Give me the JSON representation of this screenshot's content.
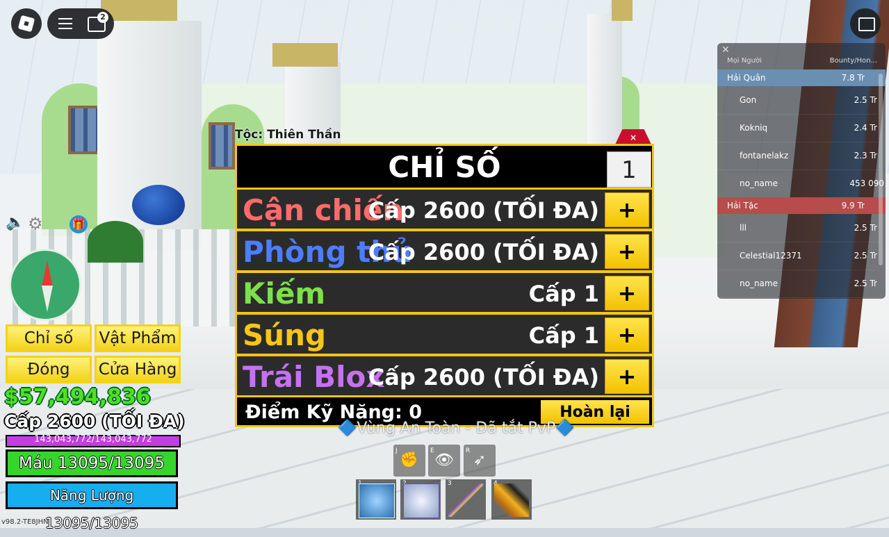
{
  "topbar": {
    "chat_badge": "2"
  },
  "leaderboard": {
    "col_name": "Mọi Người",
    "col_value": "Bounty/Hon...",
    "teams": [
      {
        "name": "Hải Quân",
        "value": "7.8 Tr",
        "color": "#6a8fb0",
        "players": [
          {
            "name": "Gon",
            "value": "2.5 Tr"
          },
          {
            "name": "Kokniq",
            "value": "2.4 Tr"
          },
          {
            "name": "fontanelakz",
            "value": "2.3 Tr"
          },
          {
            "name": "no_name",
            "value": "453 090"
          }
        ]
      },
      {
        "name": "Hải Tặc",
        "value": "9.9 Tr",
        "color": "#b84b4b",
        "players": [
          {
            "name": "lll",
            "value": "2.5 Tr"
          },
          {
            "name": "Celestial12371",
            "value": "2.5 Tr"
          },
          {
            "name": "no_name",
            "value": "2.5 Tr"
          }
        ]
      }
    ]
  },
  "stats": {
    "race": "Tộc: Thiên Thần",
    "close": "×",
    "title": "CHỈ SỐ",
    "amount": "1",
    "rows": [
      {
        "name": "Cận chiến",
        "level": "Cấp 2600 (TỐI ĐA)",
        "color": "#ff6b6b"
      },
      {
        "name": "Phòng thủ",
        "level": "Cấp 2600 (TỐI ĐA)",
        "color": "#4c7dff"
      },
      {
        "name": "Kiếm",
        "level": "Cấp 1",
        "color": "#7be04a"
      },
      {
        "name": "Súng",
        "level": "Cấp 1",
        "color": "#f5c518"
      },
      {
        "name": "Trái Blox",
        "level": "Cấp 2600 (TỐI ĐA)",
        "color": "#c571f0"
      }
    ],
    "plus": "+",
    "points": "Điểm Kỹ Năng: 0",
    "reset": "Hoàn lại"
  },
  "hud": {
    "btn_stats": "Chỉ số",
    "btn_items": "Vật Phẩm",
    "btn_close": "Đóng",
    "btn_shop": "Cửa Hàng",
    "money": "$57,494,836",
    "level": "Cấp 2600 (TỐI ĐA)",
    "xp": "143,043,772/143,043,772",
    "xp_fraction": 1.0,
    "hp": "Máu 13095/13095",
    "energy": "Năng Lượng 13095/13095",
    "version": "v98.2-TE8JHN"
  },
  "hotbar": {
    "safe_zone": "🔷Vùng An Toàn - Đã tắt PvP🔷",
    "skills": [
      {
        "key": "J",
        "icon": "fist-icon"
      },
      {
        "key": "E",
        "icon": "eye-icon"
      },
      {
        "key": "R",
        "icon": "dash-icon"
      }
    ],
    "slots": [
      {
        "key": "1",
        "icon": "fruit-ability-icon"
      },
      {
        "key": "2",
        "icon": "yeti-icon"
      },
      {
        "key": "3",
        "icon": "sword-icon"
      },
      {
        "key": "4",
        "icon": "gun-icon"
      }
    ]
  }
}
